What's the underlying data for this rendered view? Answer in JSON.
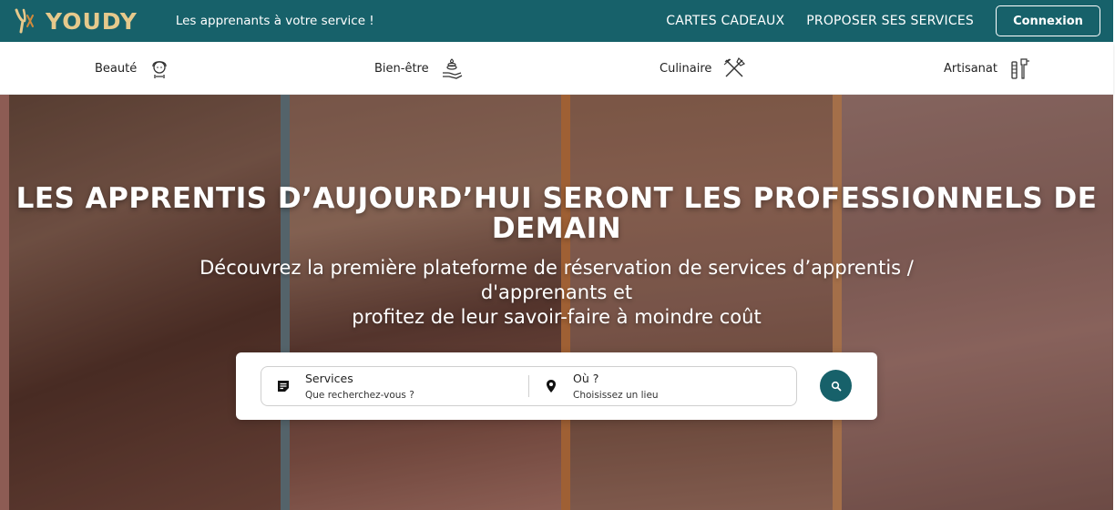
{
  "header": {
    "logo_text": "YOUDY",
    "tagline": "Les apprenants à votre service !",
    "nav": {
      "gift_cards": "CARTES CADEAUX",
      "offer_services": "PROPOSER SES SERVICES",
      "login": "Connexion"
    }
  },
  "categories": [
    {
      "label": "Beauté",
      "icon": "beauty-face-icon"
    },
    {
      "label": "Bien-être",
      "icon": "wellness-hand-icon"
    },
    {
      "label": "Culinaire",
      "icon": "cutlery-icon"
    },
    {
      "label": "Artisanat",
      "icon": "craft-tools-icon"
    }
  ],
  "hero": {
    "title": "LES APPRENTIS D’AUJOURD’HUI SERONT LES PROFESSIONNELS DE DEMAIN",
    "subtitle_line1": "Découvrez la première plateforme de réservation de services d’apprentis /",
    "subtitle_line2": "d'apprenants et",
    "subtitle_line3": "profitez de leur savoir-faire à moindre coût"
  },
  "search": {
    "services_label": "Services",
    "services_placeholder": "Que recherchez-vous ?",
    "where_label": "Où ?",
    "where_placeholder": "Choisissez un lieu",
    "button_icon": "search-icon"
  },
  "colors": {
    "brand": "#17616a",
    "logo": "#e6c98c"
  }
}
